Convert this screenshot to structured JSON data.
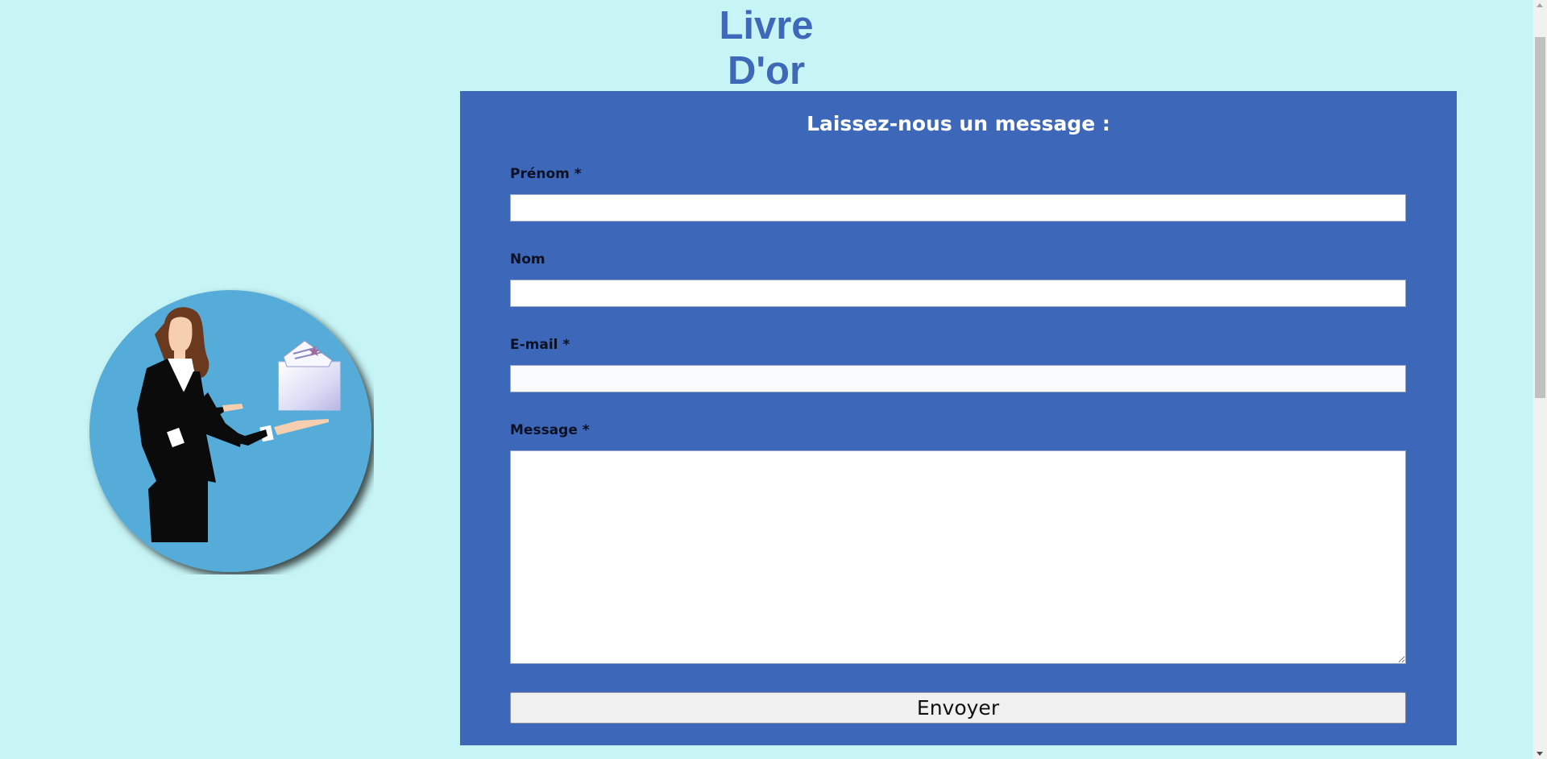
{
  "page": {
    "title": "Livre D'or"
  },
  "illustration": {
    "icon": "businesswoman-presenting-envelope-illustration"
  },
  "form": {
    "heading": "Laissez-nous un message :",
    "fields": {
      "prenom": {
        "label": "Prénom *",
        "value": "",
        "placeholder": ""
      },
      "nom": {
        "label": "Nom",
        "value": "",
        "placeholder": ""
      },
      "email": {
        "label": "E-mail *",
        "value": "",
        "placeholder": ""
      },
      "message": {
        "label": "Message *",
        "value": "",
        "placeholder": ""
      }
    },
    "submit_label": "Envoyer"
  },
  "colors": {
    "background": "#c7f5f6",
    "accent": "#3d68ba",
    "title": "#3e69b9"
  }
}
